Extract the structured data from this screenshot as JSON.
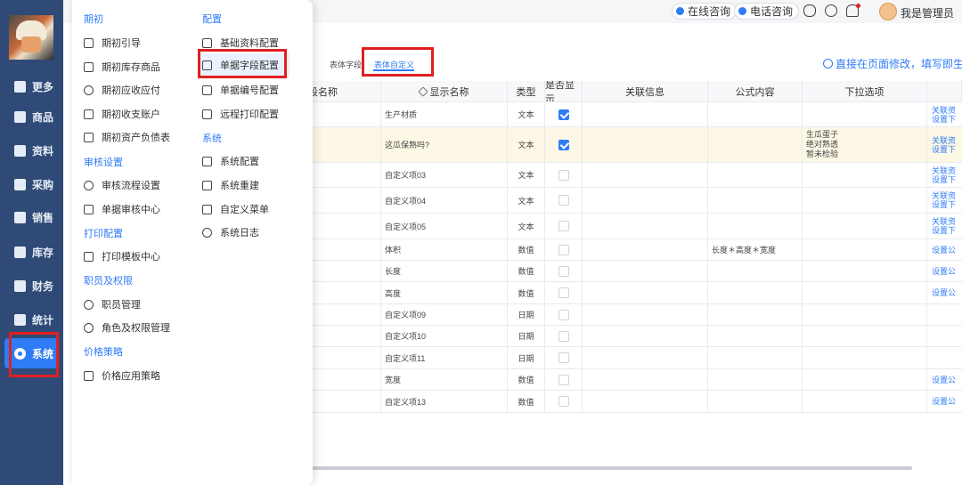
{
  "sidebar": {
    "items": [
      {
        "label": "更多",
        "icon": "plus-square-icon"
      },
      {
        "label": "商品",
        "icon": "bag-icon"
      },
      {
        "label": "资料",
        "icon": "document-icon"
      },
      {
        "label": "采购",
        "icon": "purchase-icon"
      },
      {
        "label": "销售",
        "icon": "sales-chart-icon"
      },
      {
        "label": "库存",
        "icon": "warehouse-icon"
      },
      {
        "label": "财务",
        "icon": "finance-icon"
      },
      {
        "label": "统计",
        "icon": "stats-icon"
      },
      {
        "label": "系统",
        "icon": "system-gear-icon",
        "active": true
      }
    ]
  },
  "header": {
    "online_consult": "在线咨询",
    "phone_consult": "电话咨询",
    "user_name": "我是管理员"
  },
  "menu": {
    "groups": {
      "initial": "期初",
      "review": "审核设置",
      "print": "打印配置",
      "staff": "职员及权限",
      "price": "价格策略",
      "config": "配置",
      "system": "系统"
    },
    "left_items": {
      "initial_guide": "期初引导",
      "initial_stock": "期初库存商品",
      "initial_receivable": "期初应收应付",
      "initial_account": "期初收支账户",
      "initial_assets": "期初资产负债表",
      "review_flow": "审核流程设置",
      "review_center": "单据审核中心",
      "print_templates": "打印模板中心",
      "staff_mgmt": "职员管理",
      "role_mgmt": "角色及权限管理",
      "price_policy": "价格应用策略"
    },
    "right_items": {
      "basic_config": "基础资料配置",
      "field_config": "单据字段配置",
      "numbering_config": "单据编号配置",
      "remote_print": "远程打印配置",
      "sys_config": "系统配置",
      "sys_rebuild": "系统重建",
      "custom_menu": "自定义菜单",
      "sys_log": "系统日志"
    }
  },
  "tabs": {
    "body_fields": "表体字段",
    "body_custom": "表体自定义"
  },
  "tip": "直接在页面修改，填写即生效",
  "table": {
    "headers": {
      "field_name": "段名称",
      "display_name": "显示名称",
      "type": "类型",
      "visible": "是否显示",
      "related": "关联信息",
      "formula": "公式内容",
      "options": "下拉选项"
    },
    "rows": [
      {
        "name": "生产材质",
        "type": "文本",
        "checked": true,
        "formula": "",
        "options": [],
        "links": [
          "关联资",
          "设置下"
        ]
      },
      {
        "name": "这瓜保熟吗?",
        "type": "文本",
        "checked": true,
        "formula": "",
        "options": [
          "生瓜蛋子",
          "绝对熟透",
          "暂未检验"
        ],
        "links": [
          "关联资",
          "设置下"
        ]
      },
      {
        "name": "自定义项03",
        "type": "文本",
        "checked": false,
        "formula": "",
        "options": [],
        "links": [
          "关联资",
          "设置下"
        ]
      },
      {
        "name": "自定义项04",
        "type": "文本",
        "checked": false,
        "formula": "",
        "options": [],
        "links": [
          "关联资",
          "设置下"
        ]
      },
      {
        "name": "自定义项05",
        "type": "文本",
        "checked": false,
        "formula": "",
        "options": [],
        "links": [
          "关联资",
          "设置下"
        ]
      },
      {
        "name": "体积",
        "type": "数值",
        "checked": false,
        "formula": "长度＊高度＊宽度",
        "options": [],
        "links": [
          "设置公"
        ]
      },
      {
        "name": "长度",
        "type": "数值",
        "checked": false,
        "formula": "",
        "options": [],
        "links": [
          "设置公"
        ]
      },
      {
        "name": "高度",
        "type": "数值",
        "checked": false,
        "formula": "",
        "options": [],
        "links": [
          "设置公"
        ]
      },
      {
        "name": "自定义项09",
        "type": "日期",
        "checked": false,
        "formula": "",
        "options": [],
        "links": []
      },
      {
        "name": "自定义项10",
        "type": "日期",
        "checked": false,
        "formula": "",
        "options": [],
        "links": []
      },
      {
        "name": "自定义项11",
        "type": "日期",
        "checked": false,
        "formula": "",
        "options": [],
        "links": []
      },
      {
        "name": "宽度",
        "type": "数值",
        "checked": false,
        "formula": "",
        "options": [],
        "links": [
          "设置公"
        ]
      },
      {
        "name": "自定义项13",
        "type": "数值",
        "checked": false,
        "formula": "",
        "options": [],
        "links": [
          "设置公"
        ]
      }
    ]
  },
  "colors": {
    "sidebar_bg": "#2f4a77",
    "accent": "#2f7cf6",
    "highlight_box": "#e02020",
    "highlight_row": "#fdf8e6"
  }
}
